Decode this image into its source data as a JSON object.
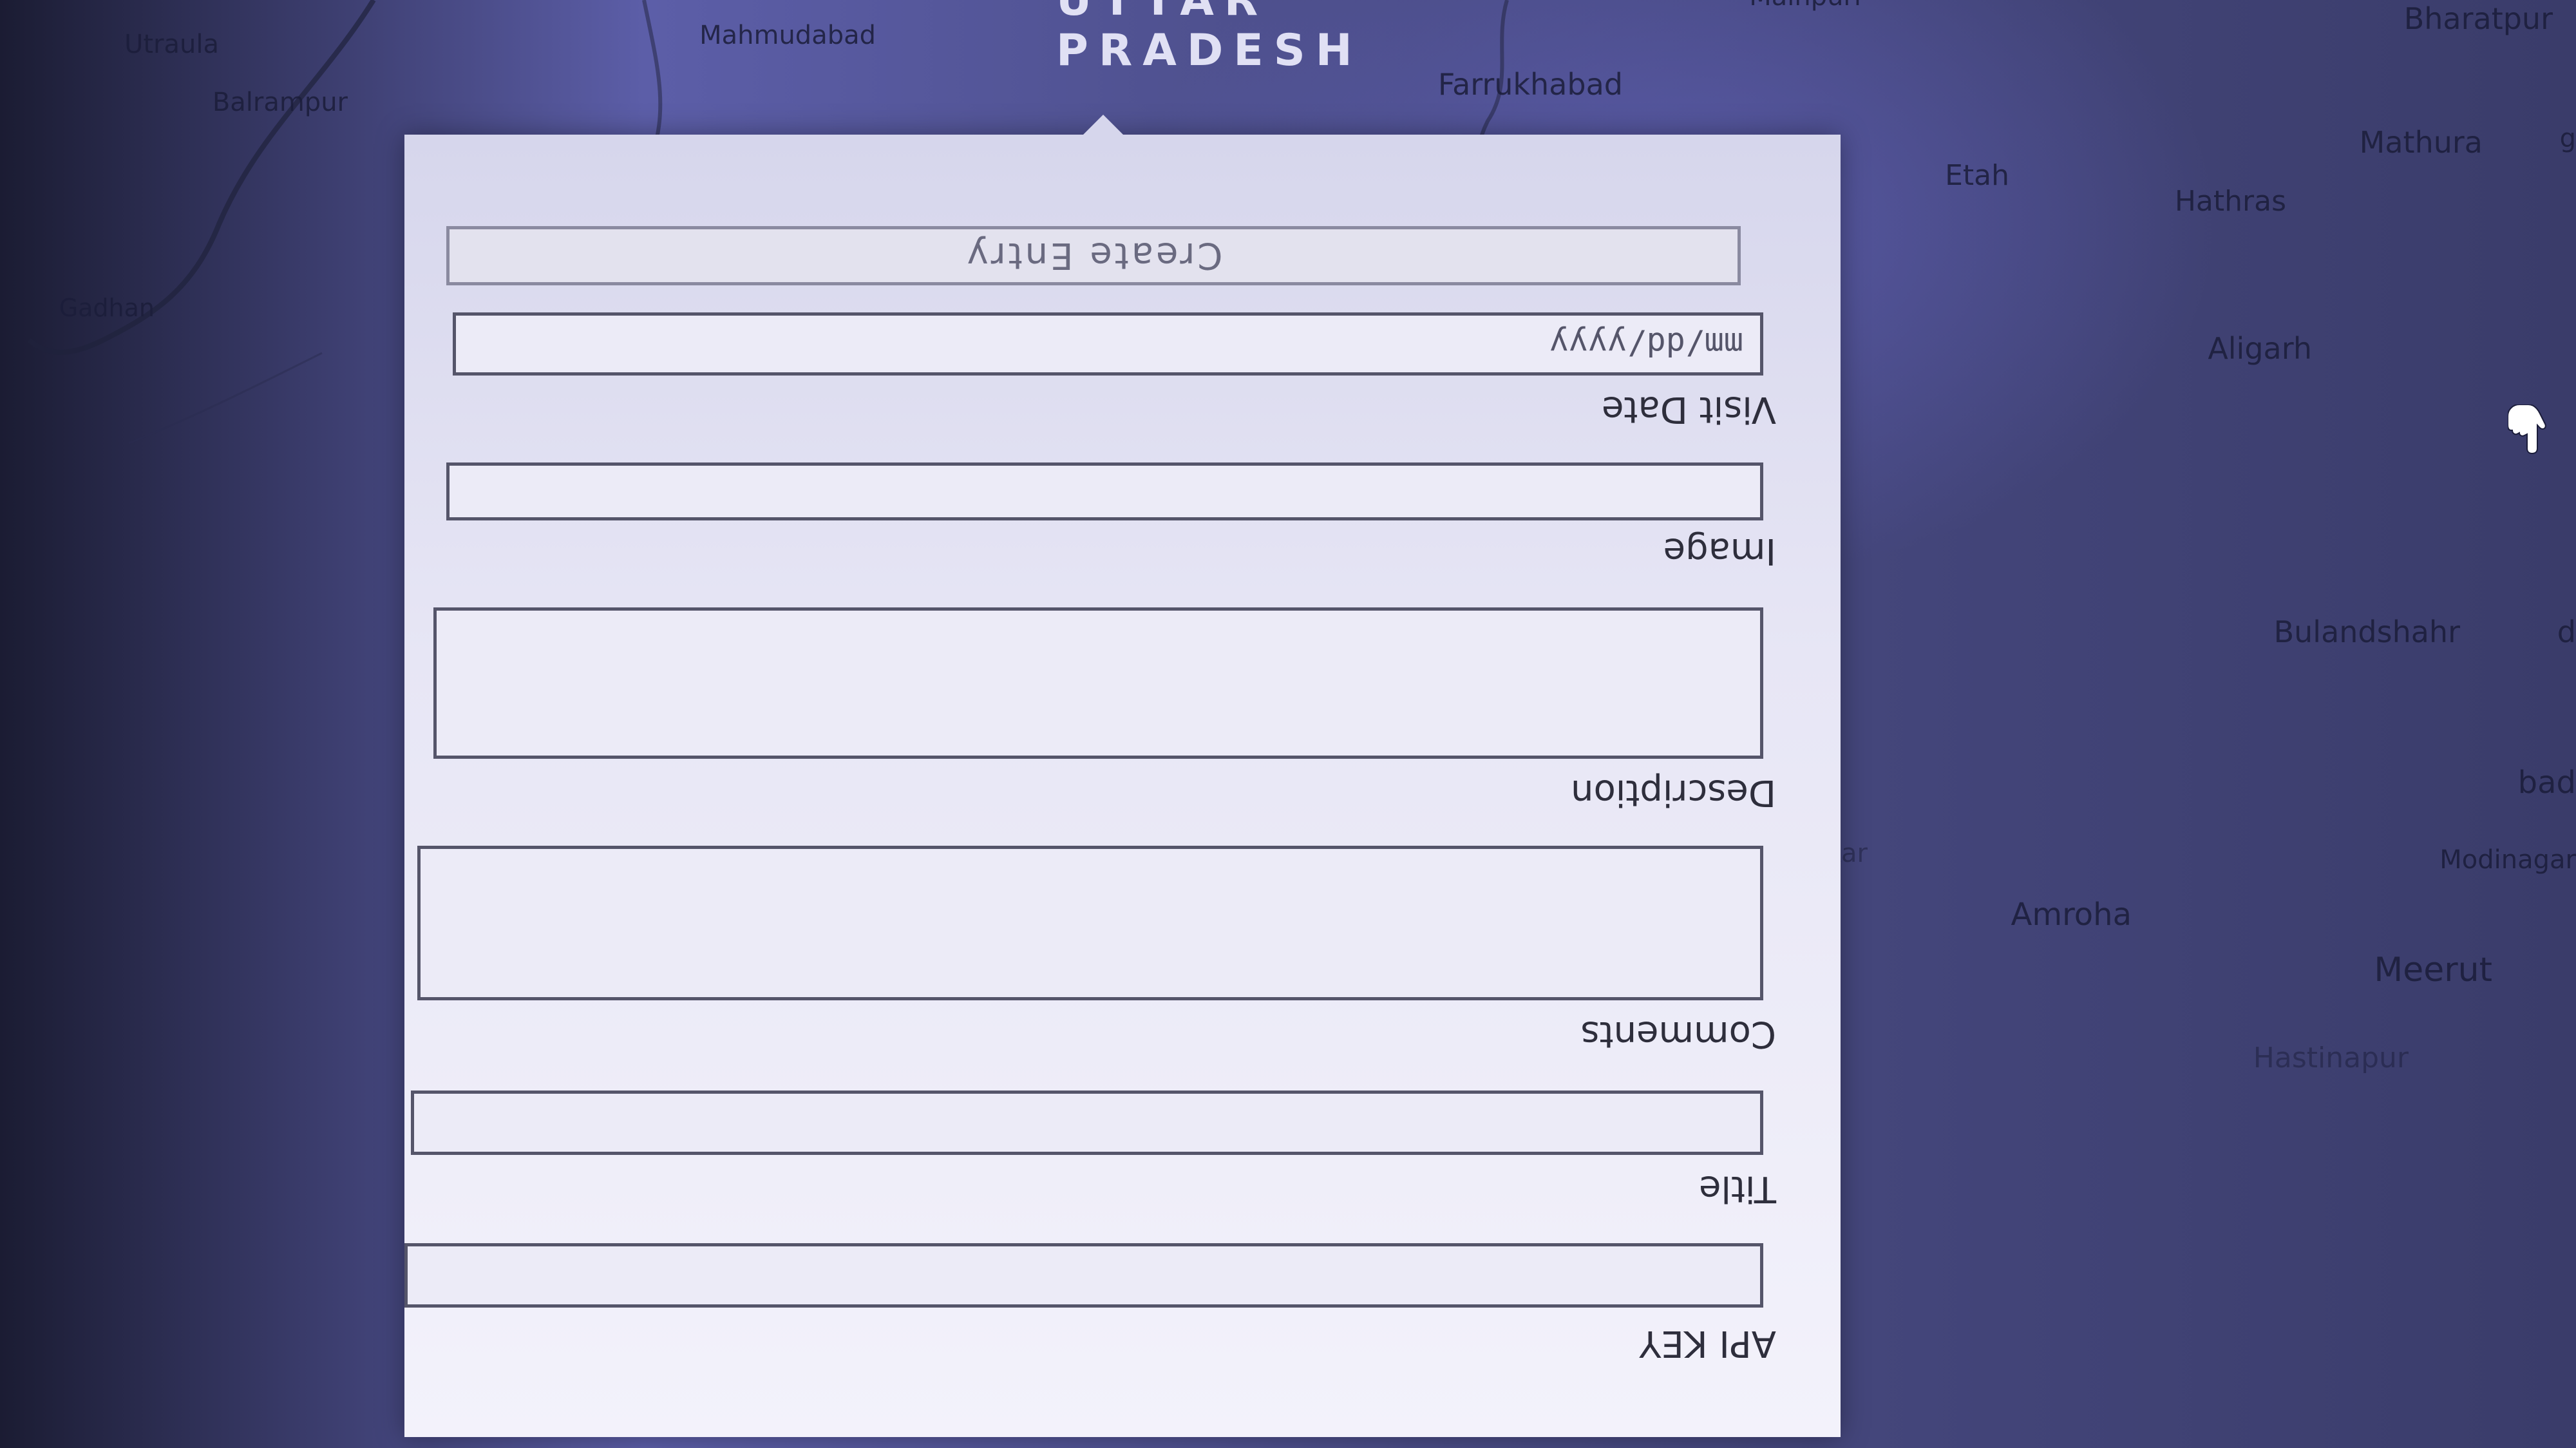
{
  "map": {
    "region_label": "UTTAR PRADESH",
    "places": [
      "Bharatpur",
      "Mainpuri",
      "Mahmudabad",
      "Utraula",
      "Farrukhabad",
      "Balrampur",
      "Mathura",
      "Etah",
      "Hathras",
      "Gadhan",
      "Aligarh",
      "Bulandshahr",
      "Modinagar",
      "Amroha",
      "Meerut",
      "Hastinapur",
      "Rar",
      "bad",
      "d",
      "g"
    ]
  },
  "form": {
    "api_key_label": "API KEY",
    "title_label": "Title",
    "comments_label": "Comments",
    "description_label": "Description",
    "image_label": "Image",
    "visit_date_label": "Visit Date",
    "visit_date_placeholder": "mm/dd/yyyy",
    "submit_label": "Create Entry"
  },
  "icons": {
    "cursor": "hand-pointer-icon"
  }
}
